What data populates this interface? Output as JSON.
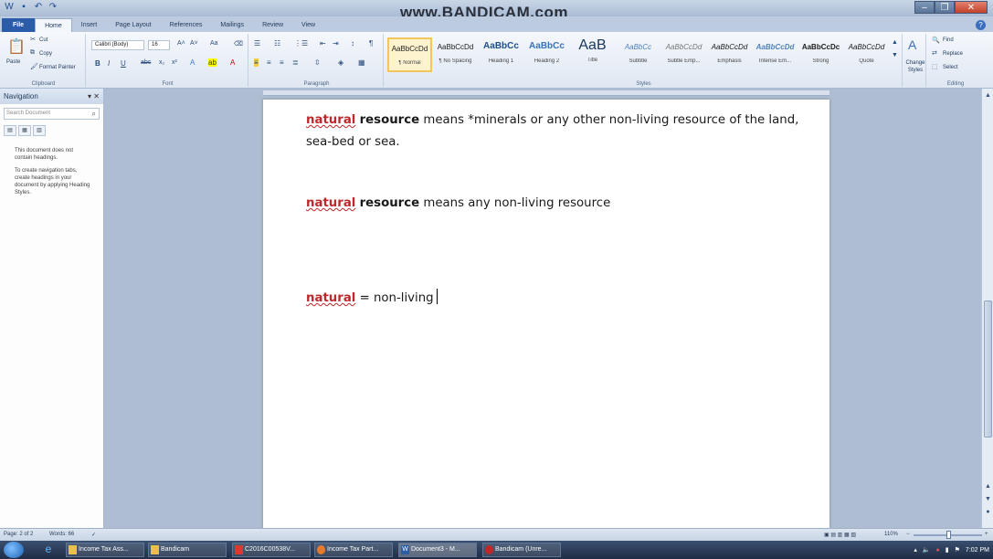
{
  "watermark": "www.BANDICAM.com",
  "tabs": [
    "File",
    "Home",
    "Insert",
    "Page Layout",
    "References",
    "Mailings",
    "Review",
    "View"
  ],
  "clipboard": {
    "paste": "Paste",
    "cut": "Cut",
    "copy": "Copy",
    "format_painter": "Format Painter",
    "label": "Clipboard"
  },
  "font": {
    "name": "Calibri (Body)",
    "size": "16",
    "label": "Font"
  },
  "paragraph": {
    "label": "Paragraph"
  },
  "styles": {
    "label": "Styles",
    "items": [
      {
        "sample": "AaBbCcDd",
        "name": "¶ Normal"
      },
      {
        "sample": "AaBbCcDd",
        "name": "¶ No Spacing"
      },
      {
        "sample": "AaBbCc",
        "name": "Heading 1"
      },
      {
        "sample": "AaBbCc",
        "name": "Heading 2"
      },
      {
        "sample": "AaB",
        "name": "Title"
      },
      {
        "sample": "AaBbCc",
        "name": "Subtitle"
      },
      {
        "sample": "AaBbCcDd",
        "name": "Subtle Emp..."
      },
      {
        "sample": "AaBbCcDd",
        "name": "Emphasis"
      },
      {
        "sample": "AaBbCcDd",
        "name": "Intense Em..."
      },
      {
        "sample": "AaBbCcDc",
        "name": "Strong"
      },
      {
        "sample": "AaBbCcDd",
        "name": "Quote"
      }
    ],
    "change_styles": "Change Styles"
  },
  "editing": {
    "find": "Find",
    "replace": "Replace",
    "select": "Select",
    "label": "Editing"
  },
  "nav": {
    "title": "Navigation",
    "search_placeholder": "Search Document",
    "msg1": "This document does not contain headings.",
    "msg2": "To create navigation tabs, create headings in your document by applying Heading Styles."
  },
  "doc": {
    "l1_kw": "natural",
    "l1_bold": "resource",
    "l1_rest": "means *minerals or any other non-living resource of the land,",
    "l2": "sea-bed or sea.",
    "l3_kw": "natural",
    "l3_bold": "resource",
    "l3_rest": "means any non-living resource",
    "l4_kw": "natural",
    "l4_rest": "= non-living"
  },
  "status": {
    "page": "Page: 2 of 2",
    "words": "Words: 66",
    "zoom": "110%"
  },
  "taskbar": {
    "items": [
      "Income Tax Ass...",
      "Bandicam",
      "C2016C00538V...",
      "Income Tax Part...",
      "Document3 - M...",
      "Bandicam (Unre..."
    ],
    "time": "7:02 PM"
  }
}
